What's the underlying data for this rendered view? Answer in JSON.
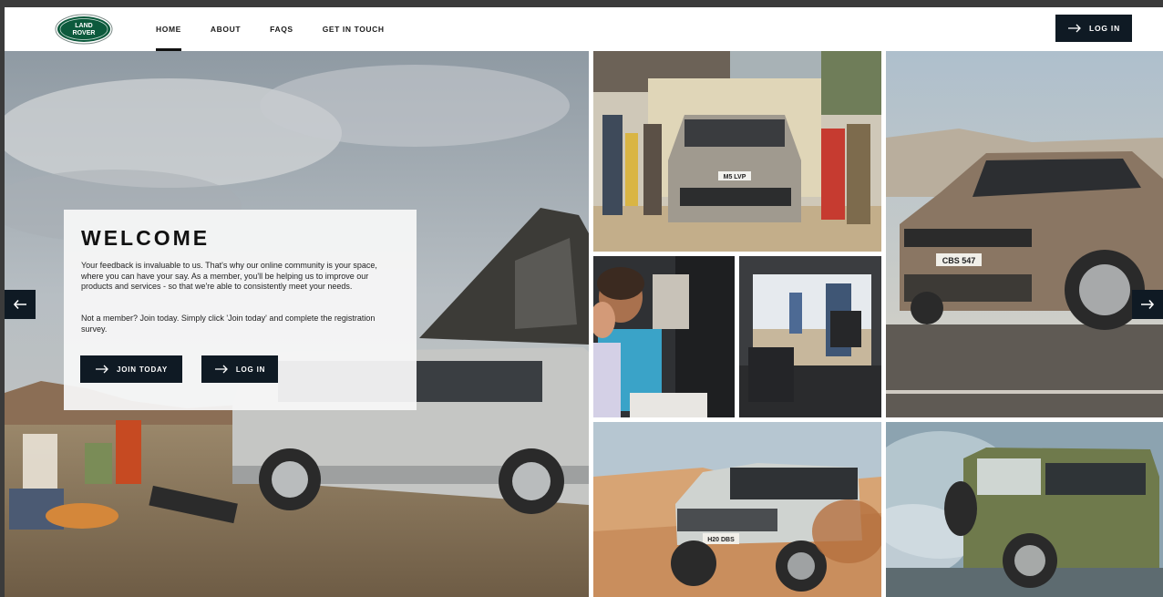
{
  "brand": {
    "logo_text_line1": "LAND",
    "logo_text_line2": "ROVER",
    "logo_color": "#0c5a3c"
  },
  "nav": {
    "items": [
      {
        "label": "HOME",
        "active": true
      },
      {
        "label": "ABOUT",
        "active": false
      },
      {
        "label": "FAQS",
        "active": false
      },
      {
        "label": "GET IN TOUCH",
        "active": false
      }
    ],
    "login_label": "LOG IN"
  },
  "welcome": {
    "title": "WELCOME",
    "paragraph1": "Your feedback is invaluable to us. That's why our online community is your space, where you can have your say. As a member, you'll be helping us to improve our products and services - so that we're able to consistently meet your needs.",
    "paragraph2": "Not a member? Join today. Simply click 'Join today' and complete the registration survey.",
    "join_label": "JOIN TODAY",
    "login_label": "LOG IN"
  },
  "plates": {
    "discovery": "M5 LVP",
    "range_rover": "CBS 547",
    "defender_desert": "H20 DBS"
  },
  "icons": {
    "arrow": "arrow-right-icon",
    "prev": "arrow-left-icon",
    "next": "arrow-right-icon"
  },
  "colors": {
    "button_bg": "#0f1a24",
    "page_bg": "#3b3b3b"
  }
}
